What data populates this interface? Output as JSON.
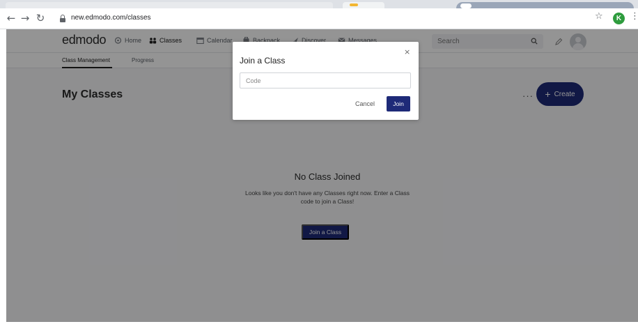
{
  "browser": {
    "url": "new.edmodo.com/classes",
    "profile_initial": "K",
    "icons": {
      "back": "back-arrow-icon",
      "forward": "forward-arrow-icon",
      "reload": "reload-icon",
      "secure": "lock-icon",
      "bookmark": "star-icon",
      "menu": "kebab-menu-icon"
    }
  },
  "nav": {
    "logo": "edmodo",
    "items": [
      {
        "label": "Home",
        "icon": "home-icon"
      },
      {
        "label": "Classes",
        "icon": "classes-icon"
      },
      {
        "label": "Calendar",
        "icon": "calendar-icon"
      },
      {
        "label": "Backpack",
        "icon": "backpack-icon"
      },
      {
        "label": "Discover",
        "icon": "discover-icon"
      },
      {
        "label": "Messages",
        "icon": "messages-icon"
      }
    ],
    "search_placeholder": "Search"
  },
  "subnav": {
    "items": [
      "Class Management",
      "Progress"
    ]
  },
  "main": {
    "title": "My Classes",
    "more": "···",
    "create_label": "Create",
    "empty_title": "No Class Joined",
    "empty_text": "Looks like you don't have any Classes right now. Enter a Class code to join a Class!",
    "join_label": "Join a Class"
  },
  "modal": {
    "title": "Join a Class",
    "close": "×",
    "code_placeholder": "Code",
    "cancel_label": "Cancel",
    "join_label": "Join"
  },
  "colors": {
    "accent": "#1e2a78",
    "overlay": "rgba(0,0,0,0.42)",
    "profile": "#2e9c3e"
  }
}
